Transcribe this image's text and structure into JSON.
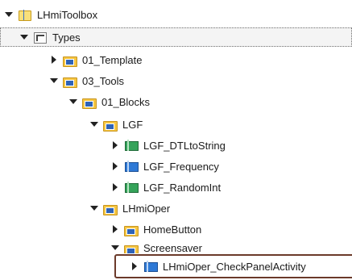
{
  "tree": {
    "nodes": [
      {
        "label": "LHmiToolbox",
        "icon": "library-icon",
        "state": "expanded"
      },
      {
        "label": "Types",
        "icon": "types-folder-icon",
        "state": "expanded"
      },
      {
        "label": "01_Template",
        "icon": "folder-icon",
        "state": "collapsed"
      },
      {
        "label": "03_Tools",
        "icon": "folder-icon",
        "state": "expanded"
      },
      {
        "label": "01_Blocks",
        "icon": "folder-icon",
        "state": "expanded"
      },
      {
        "label": "LGF",
        "icon": "folder-icon",
        "state": "expanded"
      },
      {
        "label": "LGF_DTLtoString",
        "icon": "block-green-icon",
        "state": "collapsed"
      },
      {
        "label": "LGF_Frequency",
        "icon": "block-blue-icon",
        "state": "collapsed"
      },
      {
        "label": "LGF_RandomInt",
        "icon": "block-green-icon",
        "state": "collapsed"
      },
      {
        "label": "LHmiOper",
        "icon": "folder-icon",
        "state": "expanded"
      },
      {
        "label": "HomeButton",
        "icon": "folder-icon",
        "state": "collapsed"
      },
      {
        "label": "Screensaver",
        "icon": "folder-icon",
        "state": "expanded"
      },
      {
        "label": "LHmiOper_CheckPanelActivity",
        "icon": "block-blue-icon",
        "state": "collapsed"
      }
    ]
  },
  "colors": {
    "selection_border": "#6b3a2a",
    "folder": "#f5c542",
    "block_green": "#35a35a",
    "block_blue": "#2e79d6"
  }
}
